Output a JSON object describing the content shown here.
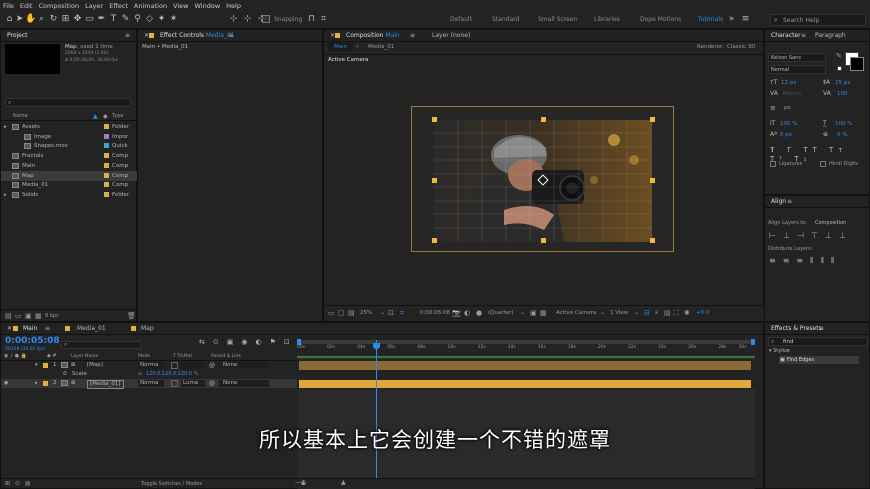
{
  "menu": [
    "File",
    "Edit",
    "Composition",
    "Layer",
    "Effect",
    "Animation",
    "View",
    "Window",
    "Help"
  ],
  "toolbar": {
    "snapping": "Snapping",
    "workspaces": [
      "Default",
      "Standard",
      "Small Screen",
      "Libraries",
      "Dope Motions",
      "Tutorials"
    ],
    "search_placeholder": "Search Help"
  },
  "project": {
    "title": "Project",
    "thumb_name": "Map",
    "thumb_used": ", used 1 time",
    "thumb_size": "2560 x 1440 (1.00)",
    "thumb_duration": "Δ 0;00;30;00, 30.00 fps",
    "col_name": "Name",
    "col_type": "Type",
    "items": [
      {
        "name": "Assets",
        "type": "Folder",
        "color": "#d9b34a",
        "indent": 0,
        "icon": "folder"
      },
      {
        "name": "Image",
        "type": "Impor",
        "color": "#a979c9",
        "indent": 1,
        "icon": "image"
      },
      {
        "name": "Shapes.mov",
        "type": "Quick",
        "color": "#3aa9c9",
        "indent": 1,
        "icon": "movie"
      },
      {
        "name": "Fractals",
        "type": "Comp",
        "color": "#d9b34a",
        "indent": 0,
        "icon": "comp"
      },
      {
        "name": "Main",
        "type": "Comp",
        "color": "#d9b34a",
        "indent": 0,
        "icon": "comp"
      },
      {
        "name": "Map",
        "type": "Comp",
        "color": "#d9b34a",
        "indent": 0,
        "icon": "comp",
        "selected": true
      },
      {
        "name": "Media_01",
        "type": "Comp",
        "color": "#d9b34a",
        "indent": 0,
        "icon": "comp"
      },
      {
        "name": "Solids",
        "type": "Folder",
        "color": "#d9b34a",
        "indent": 0,
        "icon": "folder"
      }
    ],
    "bpc": "8 bpc"
  },
  "effect_controls": {
    "tab": "Effect Controls",
    "tab_target": "Media_01",
    "breadcrumb": "Main • Media_01"
  },
  "composition": {
    "tab_prefix": "Composition",
    "tab_name": "Main",
    "layer_tab": "Layer  (none)",
    "subtabs": [
      "Main",
      "Media_01"
    ],
    "renderer_label": "Renderer:",
    "renderer": "Classic 3D",
    "camera_label": "Active Camera",
    "zoom": "25%",
    "timecode": "0;00:05:08",
    "resolution": "(Quarter)",
    "view_camera": "Active Camera",
    "views": "1 View",
    "exposure": "+0.0"
  },
  "character": {
    "tab": "Character",
    "tab2": "Paragraph",
    "font": "Kelson Sans",
    "style": "Normal",
    "size": "12 px",
    "leading": "25 px",
    "kerning": "Metrics",
    "tracking": "100",
    "stroke": "px",
    "vscale": "100 %",
    "hscale": "100 %",
    "baseline": "0 px",
    "tsume": "0 %",
    "ligatures": "Ligatures",
    "hindi": "Hindi Digits"
  },
  "align": {
    "title": "Align",
    "align_to_label": "Align Layers to:",
    "align_to": "Composition",
    "distribute": "Distribute Layers:"
  },
  "effects": {
    "title": "Effects & Presets",
    "search": "find",
    "group": "Stylize",
    "item": "Find Edges"
  },
  "timeline": {
    "tabs": [
      "Main",
      "Media_01",
      "Map"
    ],
    "timecode": "0:00:05:08",
    "frames": "00158 (30.00 fps)",
    "headers": {
      "layer": "Layer Name",
      "mode": "Mode",
      "trkmat": "T  TrkMat",
      "parent": "Parent & Link"
    },
    "layers": [
      {
        "num": "1",
        "name": "[Map]",
        "mode": "Norma",
        "trk": "",
        "parent": "None",
        "bar": "#b4883a"
      },
      {
        "num": "2",
        "name": "[Media_01]",
        "mode": "Norma",
        "trk": "Luma",
        "parent": "None",
        "bar": "#e4a83a"
      }
    ],
    "scale_label": "Scale",
    "scale_value": "120.0,120.0,120.0 %",
    "ruler": [
      "00s",
      "02s",
      "04s",
      "06s",
      "08s",
      "10s",
      "12s",
      "14s",
      "16s",
      "18s",
      "20s",
      "22s",
      "24s",
      "26s",
      "28s",
      "30s"
    ],
    "toggle": "Toggle Switches / Modes"
  },
  "subtitle": "所以基本上它会创建一个不错的遮罩"
}
